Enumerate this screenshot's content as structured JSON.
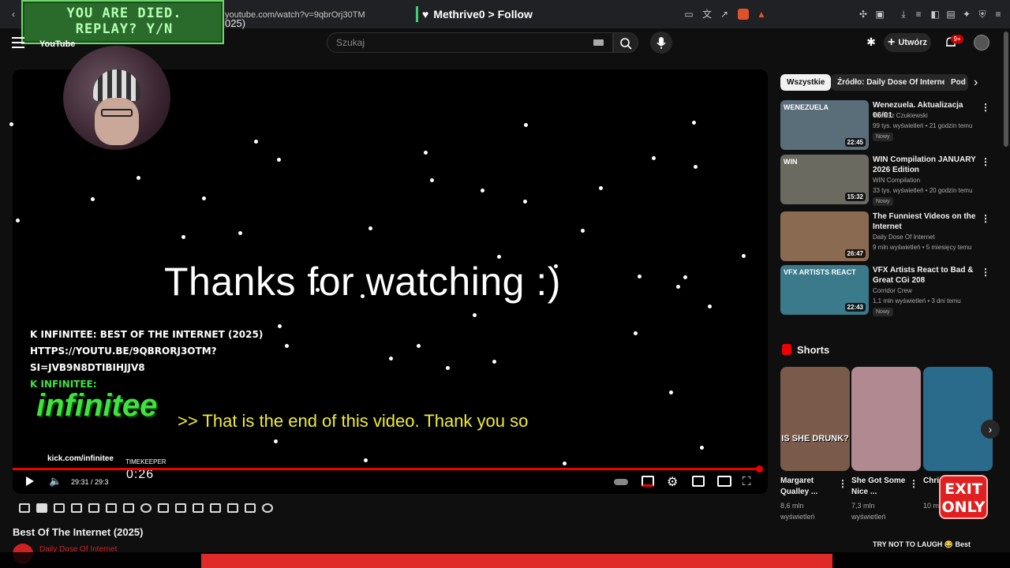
{
  "browser": {
    "url": "youtube.com/watch?v=9qbrOrj30TM",
    "title_fragment": "025)",
    "follow_banner": "Methrive0 > Follow"
  },
  "overlay_game": {
    "text": "YOU ARE DIED.\nREPLAY? Y/N"
  },
  "header": {
    "logo_text": "YouTube",
    "search_placeholder": "Szukaj",
    "create_label": "Utwórz",
    "notifications_count": "9+"
  },
  "player": {
    "end_screen_text": "Thanks for watching :)",
    "caption": ">> That is the end of this video. Thank you so",
    "stream_overlay": {
      "title_line": "K INFINITEE: BEST OF THE INTERNET (2025)",
      "url_line1": "HTTPS://YOUTU.BE/9QBRORJ3OTM?",
      "url_line2": "SI=JVB9N8DTIBIHJJV8",
      "label_line": "K INFINITEE:",
      "logo_text": "infinitee",
      "kick_url": "kick.com/infinitee",
      "timekeeper_label": "TIMEKEEPER",
      "timekeeper_value": "0:26"
    },
    "time": "29:31 / 29:3",
    "progress": 0.997
  },
  "video": {
    "title": "Best Of The Internet (2025)",
    "channel": "Daily Dose Of Internet"
  },
  "chips": [
    "Wszystkie",
    "Źródło: Daily Dose Of Internet",
    "Pod"
  ],
  "recommendations": [
    {
      "title": "Wenezuela. Aktualizacja 06/01",
      "channel": "Tomasz Czukiewski",
      "stats": "99 tys. wyświetleń • 21 godzin temu",
      "badge": "Nowy",
      "duration": "22:45",
      "thumb_text": "WENEZUELA",
      "thumb_color": "#5a6e7a"
    },
    {
      "title": "WIN Compilation JANUARY 2026 Edition",
      "channel": "WIN Compilation",
      "stats": "33 tys. wyświetleń • 20 godzin temu",
      "badge": "Nowy",
      "duration": "15:32",
      "thumb_text": "WIN",
      "thumb_color": "#6a6a60"
    },
    {
      "title": "The Funniest Videos on the Internet",
      "channel": "Daily Dose Of Internet",
      "stats": "9 mln wyświetleń • 5 miesięcy temu",
      "badge": "",
      "duration": "26:47",
      "thumb_text": "",
      "thumb_color": "#8a6a50"
    },
    {
      "title": "VFX Artists React to Bad & Great CGi 208",
      "channel": "Corridor Crew",
      "stats": "1,1 mln wyświetleń • 3 dni temu",
      "badge": "Nowy",
      "duration": "22:43",
      "thumb_text": "VFX ARTISTS REACT",
      "thumb_color": "#3a7a8a"
    }
  ],
  "shorts": {
    "section_title": "Shorts",
    "items": [
      {
        "title": "Margaret Qualley ...",
        "stats": "8,6 mln wyświetleń",
        "thumb_text": "IS SHE DRUNK?",
        "thumb_color": "#7a5a4a"
      },
      {
        "title": "She Got Some Nice ...",
        "stats": "7,3 mln wyświetleń",
        "thumb_text": "",
        "thumb_color": "#b08a90"
      },
      {
        "title": "Chri... Hem...",
        "stats": "10 m... wyś...",
        "thumb_text": "",
        "thumb_color": "#2a6a8a"
      }
    ]
  },
  "exit_badge": "EXIT\nONLY",
  "bottom_rec_title": "TRY NOT TO LAUGH 😂 Best"
}
